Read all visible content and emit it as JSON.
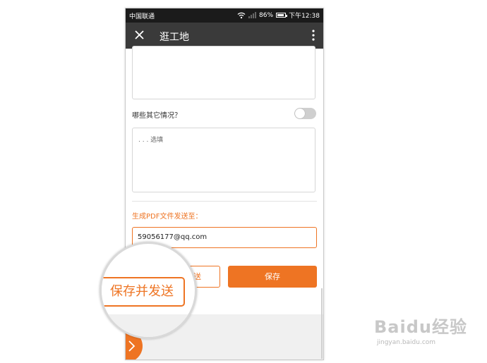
{
  "statusbar": {
    "carrier": "中国联通",
    "battery": "86%",
    "time": "下午12:38"
  },
  "appbar": {
    "title": "逛工地",
    "close_icon": "close-icon",
    "more_icon": "more-vert-icon"
  },
  "form": {
    "question_label": "哪些其它情况？",
    "toggle_on": false,
    "textarea_placeholder": ". . . 选填",
    "pdf_label": "生成PDF文件发送至：",
    "email_value": "59056177@qq.com",
    "send_button_partial": "送",
    "save_button": "保存"
  },
  "magnifier": {
    "button_label": "保存并发送"
  },
  "watermark": {
    "logo": "Baidu经验",
    "url": "jingyan.baidu.com"
  },
  "colors": {
    "accent": "#ee7423",
    "appbar": "#3a3a3a",
    "statusbar": "#1b1b1b"
  }
}
